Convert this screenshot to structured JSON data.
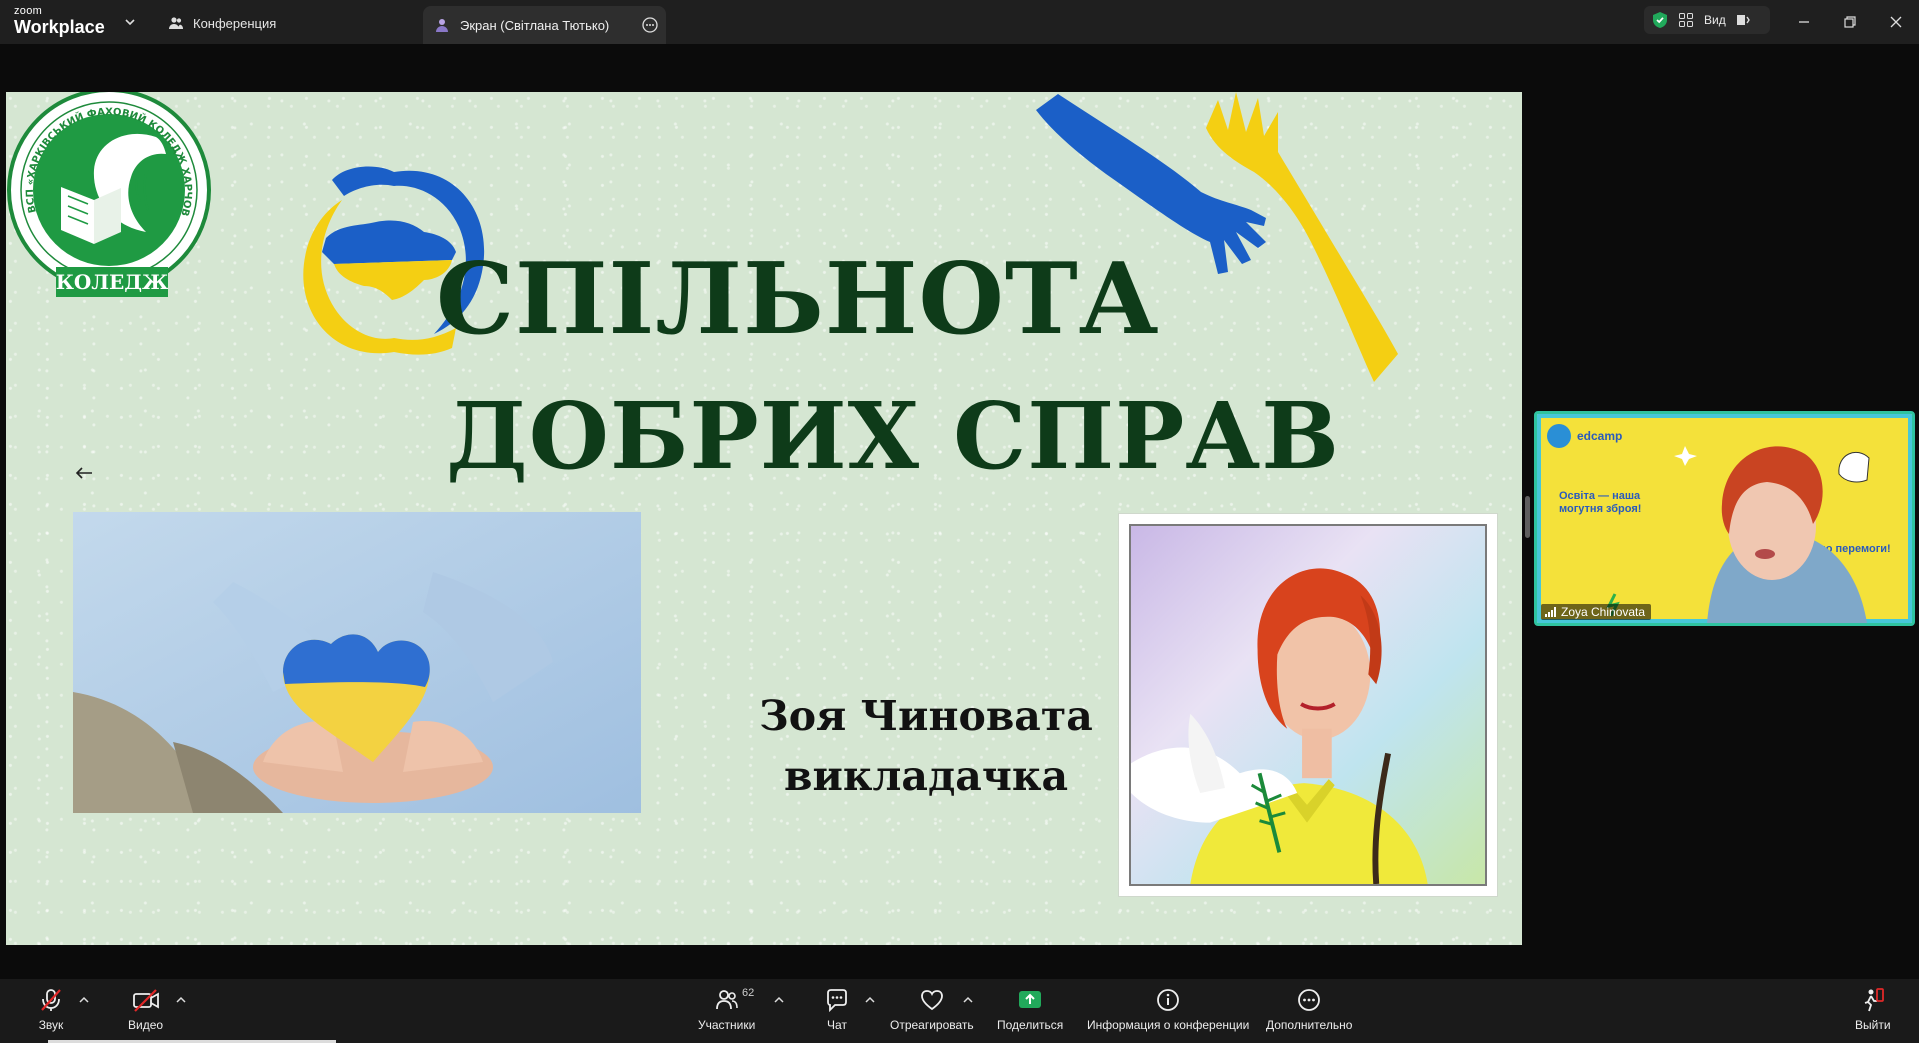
{
  "titlebar": {
    "logo_small": "zoom",
    "logo_large": "Workplace",
    "meeting_tab_label": "Конференция",
    "screen_tab_label": "Экран (Світлана Тютько)",
    "view_label": "Вид"
  },
  "slide": {
    "title_line1": "СПІЛЬНОТА",
    "title_line2": "ДОБРИХ СПРАВ",
    "speaker_name": "Зоя Чиновата",
    "speaker_role": "викладачка",
    "college_label": "КОЛЕДЖ",
    "college_ring_text": "ВСП «ХАРКІВСЬКИЙ ФАХОВИЙ КОЛЕДЖ ХАРЧОВОЇ ПРОМИСЛОВОСТІ ДБТУ»"
  },
  "participant": {
    "name": "Zoya Chinovata",
    "banner_brand": "edcamp",
    "banner_text_1": "Освіта — наша",
    "banner_text_2": "могутня зброя!",
    "banner_text_3": "ом до перемоги!"
  },
  "toolbar": {
    "audio_label": "Звук",
    "video_label": "Видео",
    "participants_label": "Участники",
    "participants_count": "62",
    "chat_label": "Чат",
    "react_label": "Отреагировать",
    "share_label": "Поделиться",
    "info_label": "Информация о конференции",
    "more_label": "Дополнительно",
    "leave_label": "Выйти"
  },
  "colors": {
    "zoom_green": "#21a95b",
    "thumb_border": "#2fc3a0",
    "slide_bg": "#d5e6d2",
    "title_green": "#0e3b19",
    "ua_blue": "#1b5fc7",
    "ua_yellow": "#f4cf13"
  }
}
